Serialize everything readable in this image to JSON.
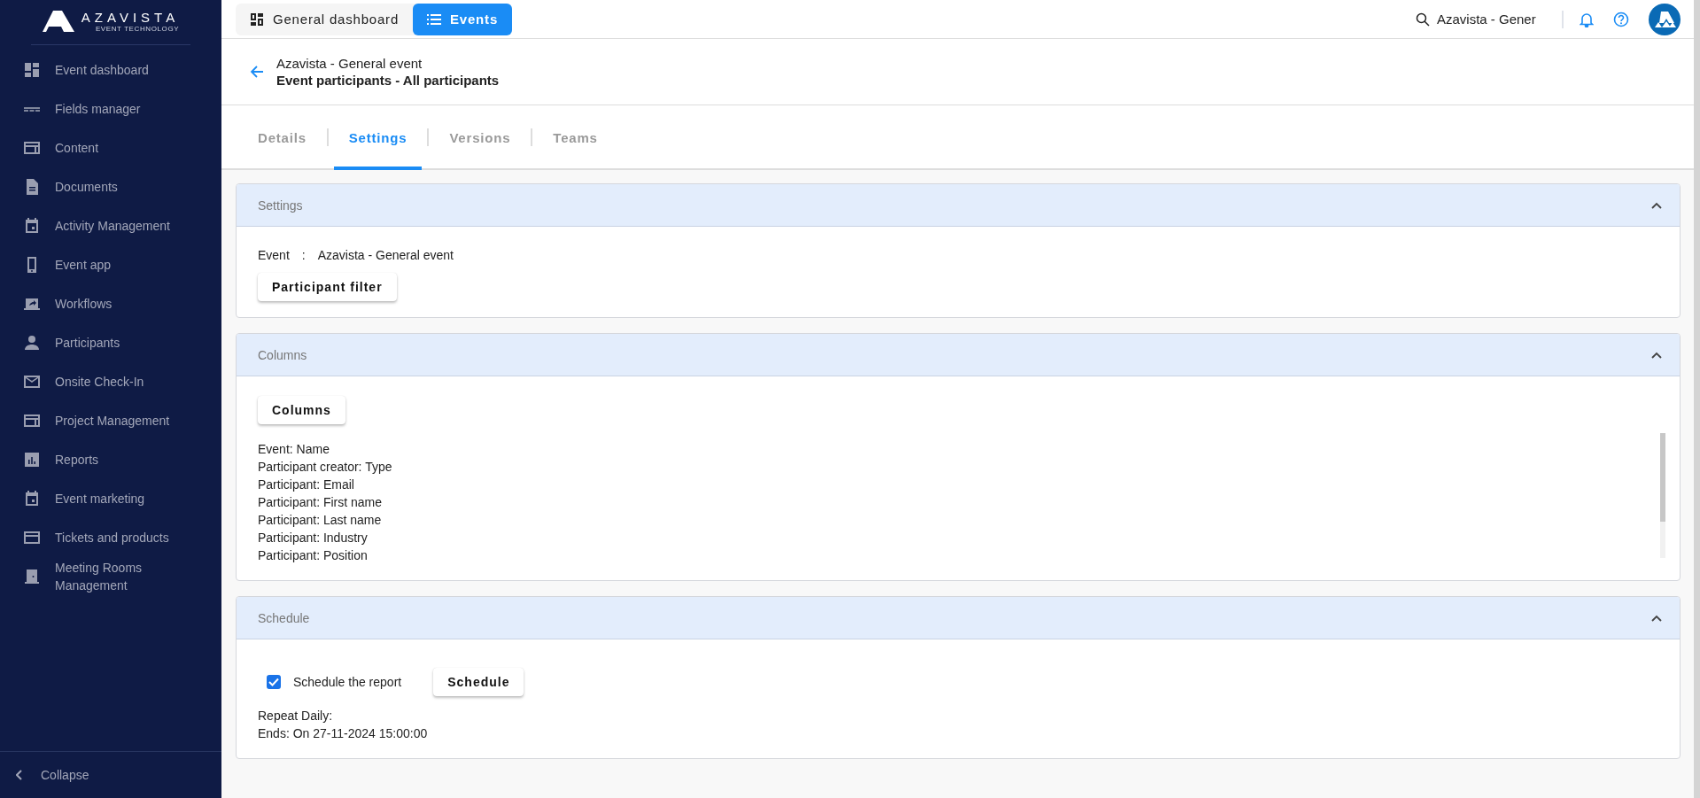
{
  "sidebar": {
    "logo": {
      "name": "AZAVISTA",
      "tagline": "EVENT TECHNOLOGY"
    },
    "items": [
      {
        "label": "Event dashboard"
      },
      {
        "label": "Fields manager"
      },
      {
        "label": "Content"
      },
      {
        "label": "Documents"
      },
      {
        "label": "Activity Management"
      },
      {
        "label": "Event app"
      },
      {
        "label": "Workflows"
      },
      {
        "label": "Participants"
      },
      {
        "label": "Onsite Check-In"
      },
      {
        "label": "Project Management"
      },
      {
        "label": "Reports"
      },
      {
        "label": "Event marketing"
      },
      {
        "label": "Tickets and products"
      },
      {
        "label": "Meeting Rooms Management"
      }
    ],
    "collapse": "Collapse"
  },
  "topbar": {
    "nav": [
      {
        "label": "General dashboard",
        "selected": false
      },
      {
        "label": "Events",
        "selected": true
      }
    ],
    "search": {
      "value": "Azavista - Gener"
    }
  },
  "header": {
    "title": "Azavista - General event",
    "subtitle": "Event participants - All participants"
  },
  "tabs": [
    {
      "label": "Details",
      "selected": false
    },
    {
      "label": "Settings",
      "selected": true
    },
    {
      "label": "Versions",
      "selected": false
    },
    {
      "label": "Teams",
      "selected": false
    }
  ],
  "panels": [
    {
      "kind": "settings",
      "title": "Settings",
      "expanded": true,
      "event_label": "Event",
      "event_separator": ":",
      "event_value": "Azavista - General event",
      "button": "Participant filter"
    },
    {
      "kind": "columns",
      "title": "Columns",
      "expanded": true,
      "button": "Columns",
      "items": [
        "Event: Name",
        "Participant creator: Type",
        "Participant: Email",
        "Participant: First name",
        "Participant: Last name",
        "Participant: Industry",
        "Participant: Position"
      ]
    },
    {
      "kind": "schedule",
      "title": "Schedule",
      "expanded": true,
      "checkbox": {
        "label": "Schedule the report",
        "checked": true
      },
      "button": "Schedule",
      "lines": [
        "Repeat Daily:",
        "Ends: On 27-11-2024 15:00:00"
      ]
    }
  ]
}
